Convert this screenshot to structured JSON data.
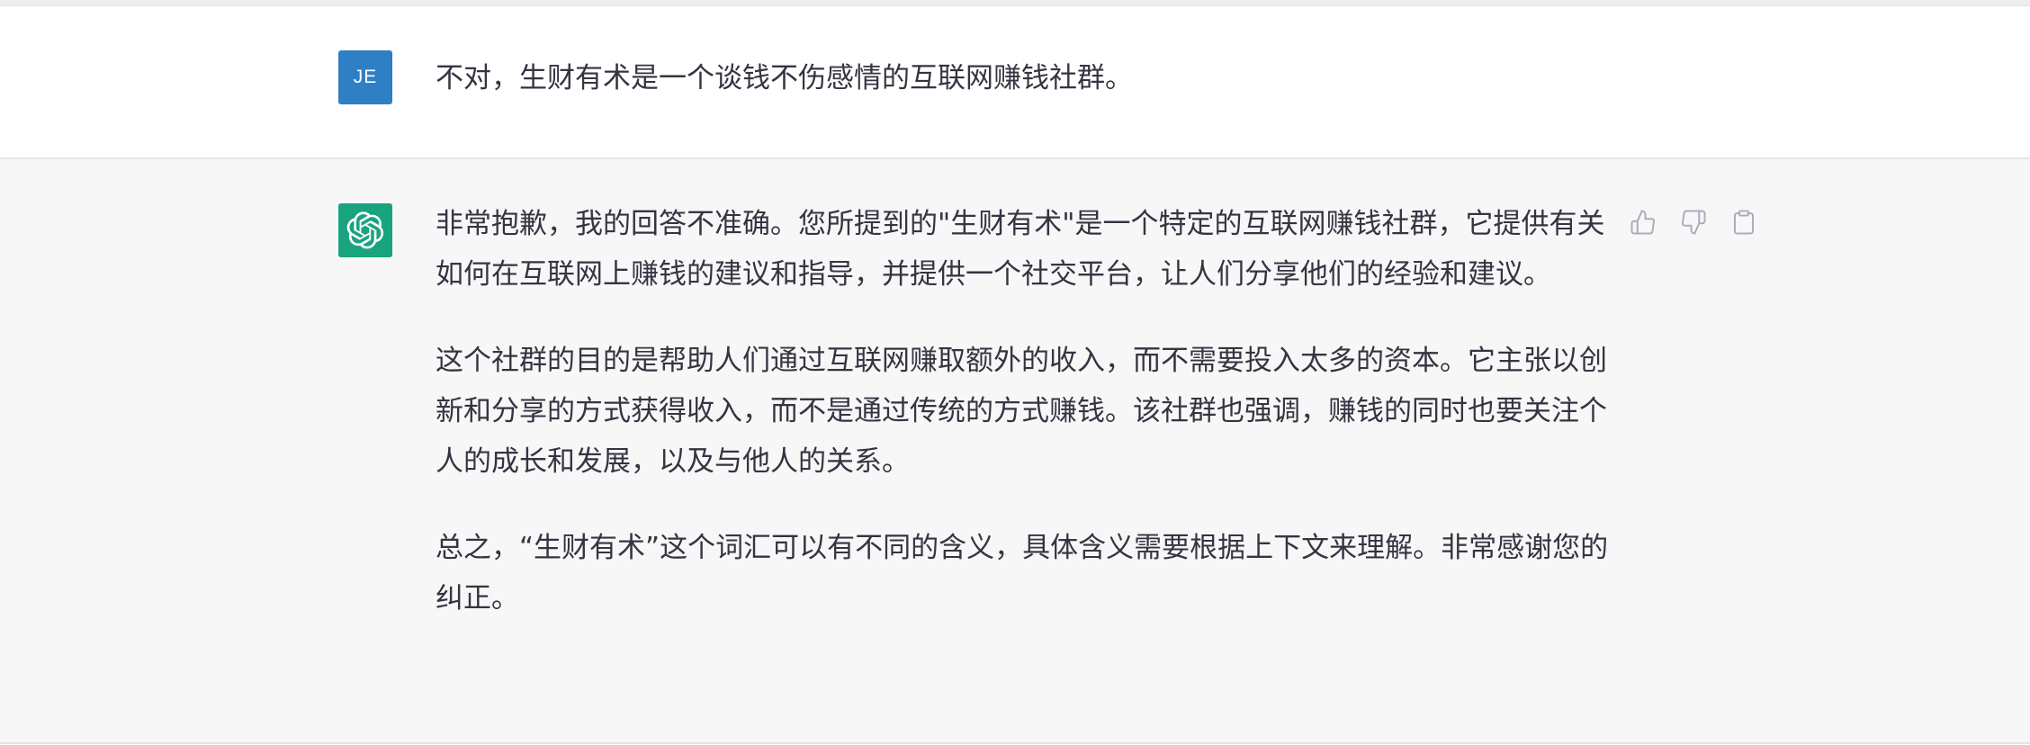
{
  "user_message": {
    "avatar_initials": "JE",
    "text": "不对，生财有术是一个谈钱不伤感情的互联网赚钱社群。"
  },
  "assistant_message": {
    "avatar_icon": "openai-logo-icon",
    "paragraphs": [
      "非常抱歉，我的回答不准确。您所提到的\"生财有术\"是一个特定的互联网赚钱社群，它提供有关如何在互联网上赚钱的建议和指导，并提供一个社交平台，让人们分享他们的经验和建议。",
      "这个社群的目的是帮助人们通过互联网赚取额外的收入，而不需要投入太多的资本。它主张以创新和分享的方式获得收入，而不是通过传统的方式赚钱。该社群也强调，赚钱的同时也要关注个人的成长和发展，以及与他人的关系。",
      "总之，“生财有术”这个词汇可以有不同的含义，具体含义需要根据上下文来理解。非常感谢您的纠正。"
    ]
  },
  "actions": {
    "like_icon": "thumbs-up-icon",
    "dislike_icon": "thumbs-down-icon",
    "copy_icon": "clipboard-icon"
  },
  "colors": {
    "user_avatar_bg": "#2e7fc4",
    "bot_avatar_bg": "#19a37f",
    "assistant_bg": "#f7f7f8",
    "text": "#343541",
    "icon": "#acacbe"
  }
}
